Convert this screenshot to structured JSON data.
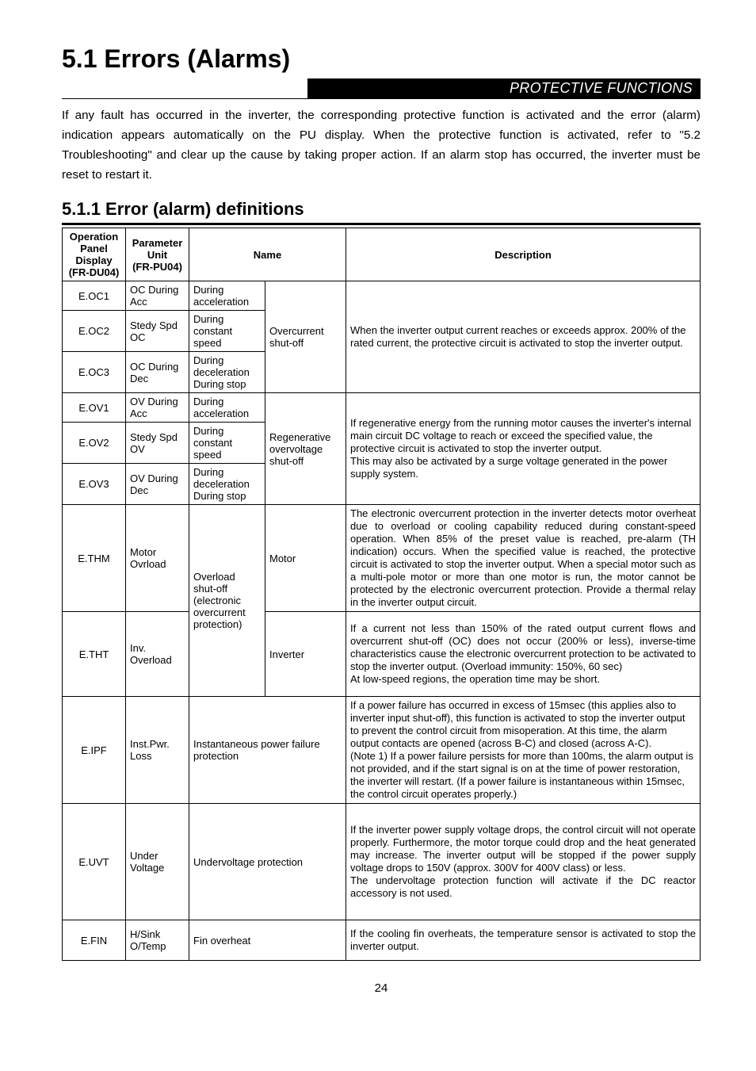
{
  "page": {
    "title": "5.1   Errors (Alarms)",
    "banner": "PROTECTIVE FUNCTIONS",
    "intro": "If any fault has occurred in the inverter, the corresponding protective function is activated and the error (alarm) indication appears automatically on the PU display. When the protective function is activated, refer to \"5.2 Troubleshooting\" and clear up the cause by taking proper action. If an alarm stop has occurred, the inverter must be reset to restart it.",
    "subsection": "5.1.1   Error (alarm) definitions",
    "page_number": "24"
  },
  "table": {
    "headers": {
      "op": "Operation Panel Display (FR-DU04)",
      "pu": "Parameter Unit\n(FR-PU04)",
      "name": "Name",
      "desc": "Description"
    },
    "rows": {
      "oc": {
        "r1": {
          "op": "E.OC1",
          "pu": "OC During Acc",
          "phase": "During acceleration"
        },
        "r2": {
          "op": "E.OC2",
          "pu": "Stedy Spd OC",
          "phase": "During constant speed"
        },
        "r3": {
          "op": "E.OC3",
          "pu": "OC During Dec",
          "phase1": "During deceleration",
          "phase2": "During stop"
        },
        "nameGroup": "Overcurrent shut-off",
        "desc": "When the inverter output current reaches or exceeds approx. 200% of the rated current, the protective circuit is activated to stop the inverter output."
      },
      "ov": {
        "r1": {
          "op": "E.OV1",
          "pu": "OV During Acc",
          "phase": "During acceleration"
        },
        "r2": {
          "op": "E.OV2",
          "pu": "Stedy Spd OV",
          "phase": "During constant speed"
        },
        "r3": {
          "op": "E.OV3",
          "pu": "OV During Dec",
          "phase1": "During deceleration",
          "phase2": "During stop"
        },
        "nameGroup": "Regenerative overvoltage shut-off",
        "desc": "If regenerative energy from the running motor causes the inverter's internal main circuit DC voltage to reach or exceed the specified value, the protective circuit is activated to stop the inverter output.\nThis may also be activated by a surge voltage generated in the power supply system."
      },
      "thm": {
        "op": "E.THM",
        "pu": "Motor Ovrload",
        "nameGroup": "Overload shut-off (electronic overcurrent protection)",
        "phase": "Motor",
        "desc": "The electronic overcurrent protection in the inverter detects motor overheat due to overload or cooling capability reduced during constant-speed operation. When 85% of the preset value is reached, pre-alarm (TH indication) occurs. When the specified value is reached, the protective circuit is activated to stop the inverter output. When a special motor such as a multi-pole motor or more than one motor is run, the motor cannot be protected by the electronic overcurrent protection. Provide a thermal relay in the inverter output circuit."
      },
      "tht": {
        "op": "E.THT",
        "pu": "Inv. Overload",
        "phase": "Inverter",
        "desc": "If a current not less than 150% of the rated output current flows and overcurrent shut-off (OC) does not occur (200% or less), inverse-time characteristics cause the electronic overcurrent protection to be activated to stop the inverter output. (Overload immunity: 150%, 60 sec)\nAt low-speed regions, the operation time may be short."
      },
      "ipf": {
        "op": "E.IPF",
        "pu": "Inst.Pwr. Loss",
        "name": "Instantaneous power failure protection",
        "desc": "If a power failure has occurred in excess of 15msec (this applies also to inverter input shut-off), this function is activated to stop the inverter output to prevent the control circuit from misoperation. At this time, the alarm output contacts are opened (across B-C) and closed (across A-C).\n(Note 1) If a power failure persists for more than 100ms, the alarm output is not provided, and if the start signal is on at the time of power restoration, the inverter will restart. (If a power failure is instantaneous within 15msec, the control circuit operates properly.)"
      },
      "uvt": {
        "op": "E.UVT",
        "pu": "Under Voltage",
        "name": "Undervoltage protection",
        "desc": "If the inverter power supply voltage drops, the control circuit will not operate properly. Furthermore, the motor torque could drop and the heat generated may increase. The inverter output will be stopped if the power supply voltage drops to 150V (approx. 300V for 400V class) or less.\nThe undervoltage protection function will activate if the DC reactor accessory is not used."
      },
      "fin": {
        "op": "E.FIN",
        "pu": "H/Sink O/Temp",
        "name": "Fin overheat",
        "desc": "If the cooling fin overheats, the temperature sensor is activated to stop the inverter output."
      }
    }
  }
}
